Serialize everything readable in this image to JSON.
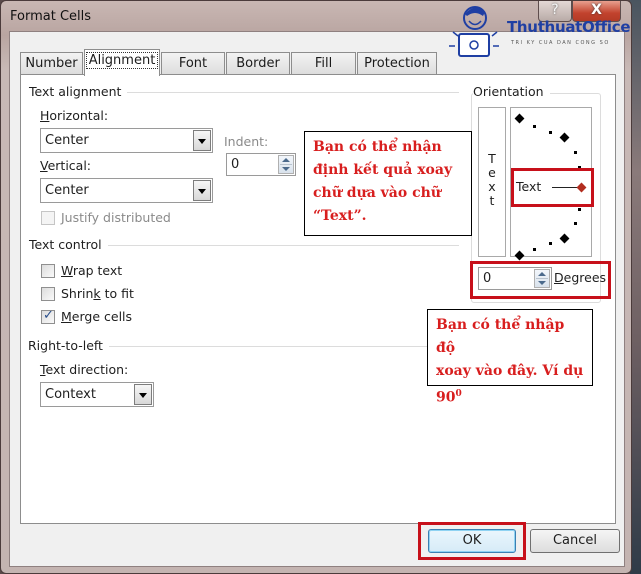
{
  "window": {
    "title": "Format Cells",
    "help_label": "?",
    "close_label": "X"
  },
  "logo": {
    "name": "ThuthuatOffice",
    "tagline": "TRI KY CUA DAN CONG SO"
  },
  "tabs": [
    {
      "label": "Number",
      "active": false
    },
    {
      "label": "Alignment",
      "active": true
    },
    {
      "label": "Font",
      "active": false
    },
    {
      "label": "Border",
      "active": false
    },
    {
      "label": "Fill",
      "active": false
    },
    {
      "label": "Protection",
      "active": false
    }
  ],
  "text_alignment": {
    "group_label": "Text alignment",
    "horizontal_label_access": "H",
    "horizontal_label_rest": "orizontal:",
    "horizontal_value": "Center",
    "indent_label": "Indent:",
    "indent_value": "0",
    "vertical_label_access": "V",
    "vertical_label_rest": "ertical:",
    "vertical_value": "Center",
    "justify_label": "Justify distributed",
    "justify_checked": false
  },
  "text_control": {
    "group_label": "Text control",
    "wrap_access": "W",
    "wrap_rest": "rap text",
    "wrap_checked": false,
    "shrink_pre": "Shrin",
    "shrink_access": "k",
    "shrink_rest": " to fit",
    "shrink_checked": false,
    "merge_access": "M",
    "merge_rest": "erge cells",
    "merge_checked": true,
    "check_mark": "✓"
  },
  "right_to_left": {
    "group_label": "Right-to-left",
    "direction_access": "T",
    "direction_rest": "ext direction:",
    "direction_value": "Context"
  },
  "orientation": {
    "group_label": "Orientation",
    "vertical_text": [
      "T",
      "e",
      "x",
      "t"
    ],
    "dial_text": "Text",
    "degrees_value": "0",
    "degrees_access": "D",
    "degrees_rest": "egrees"
  },
  "annotations": {
    "note1": [
      "Bạn có thể nhận",
      "định kết quả xoay",
      "chữ dựa vào chữ",
      "“Text”."
    ],
    "note2_lines": [
      "Bạn có thể nhập độ",
      "xoay vào đây. Ví dụ"
    ],
    "note2_value": "90",
    "note2_sup": "0",
    "highlight_color": "#c7101a",
    "note_text_color": "#d81e1e"
  },
  "buttons": {
    "ok": "OK",
    "cancel": "Cancel"
  }
}
